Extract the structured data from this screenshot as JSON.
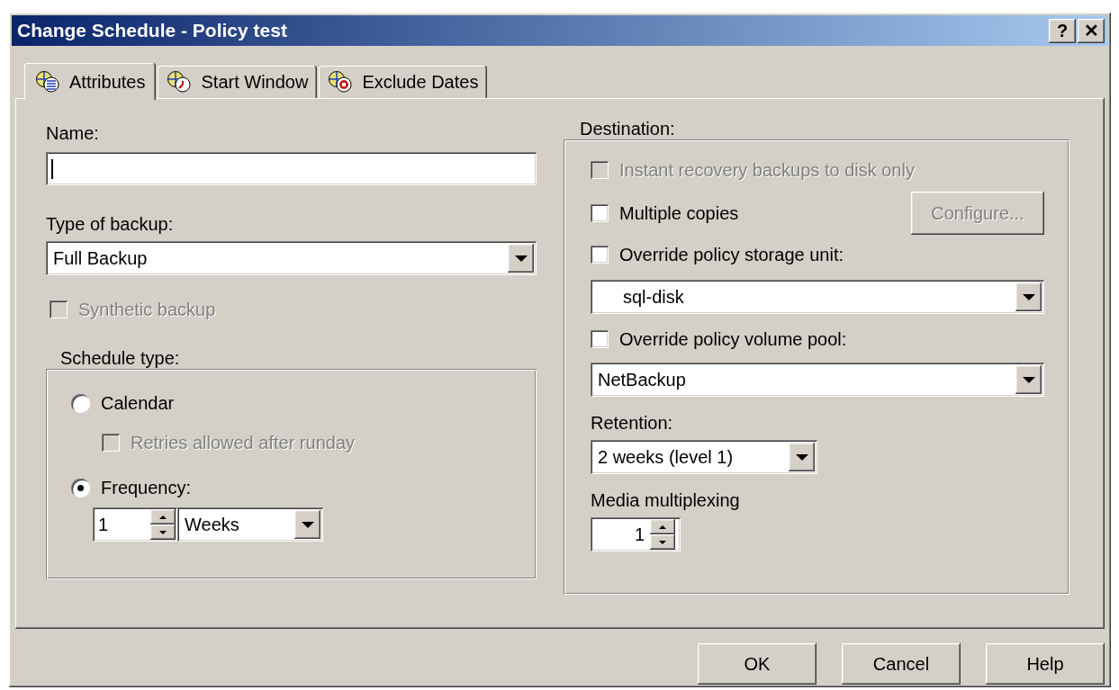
{
  "window": {
    "title": "Change Schedule - Policy test",
    "help_button": "?",
    "close_button": "✕"
  },
  "tabs": [
    {
      "label": "Attributes",
      "selected": true
    },
    {
      "label": "Start Window",
      "selected": false
    },
    {
      "label": "Exclude Dates",
      "selected": false
    }
  ],
  "attributes": {
    "name": {
      "label": "Name:"
    },
    "type_of_backup": {
      "label": "Type of backup:",
      "value": "Full Backup"
    },
    "synthetic_backup": {
      "label": "Synthetic backup",
      "checked": false,
      "disabled": true
    },
    "schedule_type": {
      "legend": "Schedule type:",
      "options": [
        {
          "label": "Calendar",
          "selected": false
        },
        {
          "label": "Frequency:",
          "selected": true
        }
      ],
      "retries": {
        "label": "Retries allowed after runday",
        "checked": false,
        "disabled": true
      },
      "frequency": {
        "value": "1",
        "unit": "Weeks"
      }
    }
  },
  "destination": {
    "legend": "Destination:",
    "checks": [
      {
        "label": "Instant recovery backups to disk only",
        "checked": false,
        "disabled": true
      },
      {
        "label": "Multiple copies",
        "checked": false,
        "disabled": false
      },
      {
        "label": "Override policy storage unit:",
        "checked": false,
        "disabled": false
      },
      {
        "label": "Override policy volume pool:",
        "checked": false,
        "disabled": false
      }
    ],
    "configure_button": {
      "label": "Configure...",
      "disabled": true
    },
    "storage_unit": {
      "value": "sql-disk"
    },
    "volume_pool": {
      "value": "NetBackup"
    },
    "retention": {
      "label": "Retention:",
      "value": "2 weeks (level 1)"
    },
    "multiplexing": {
      "label": "Media multiplexing",
      "value": "1"
    }
  },
  "buttons": [
    {
      "label": "OK"
    },
    {
      "label": "Cancel"
    },
    {
      "label": "Help"
    }
  ]
}
